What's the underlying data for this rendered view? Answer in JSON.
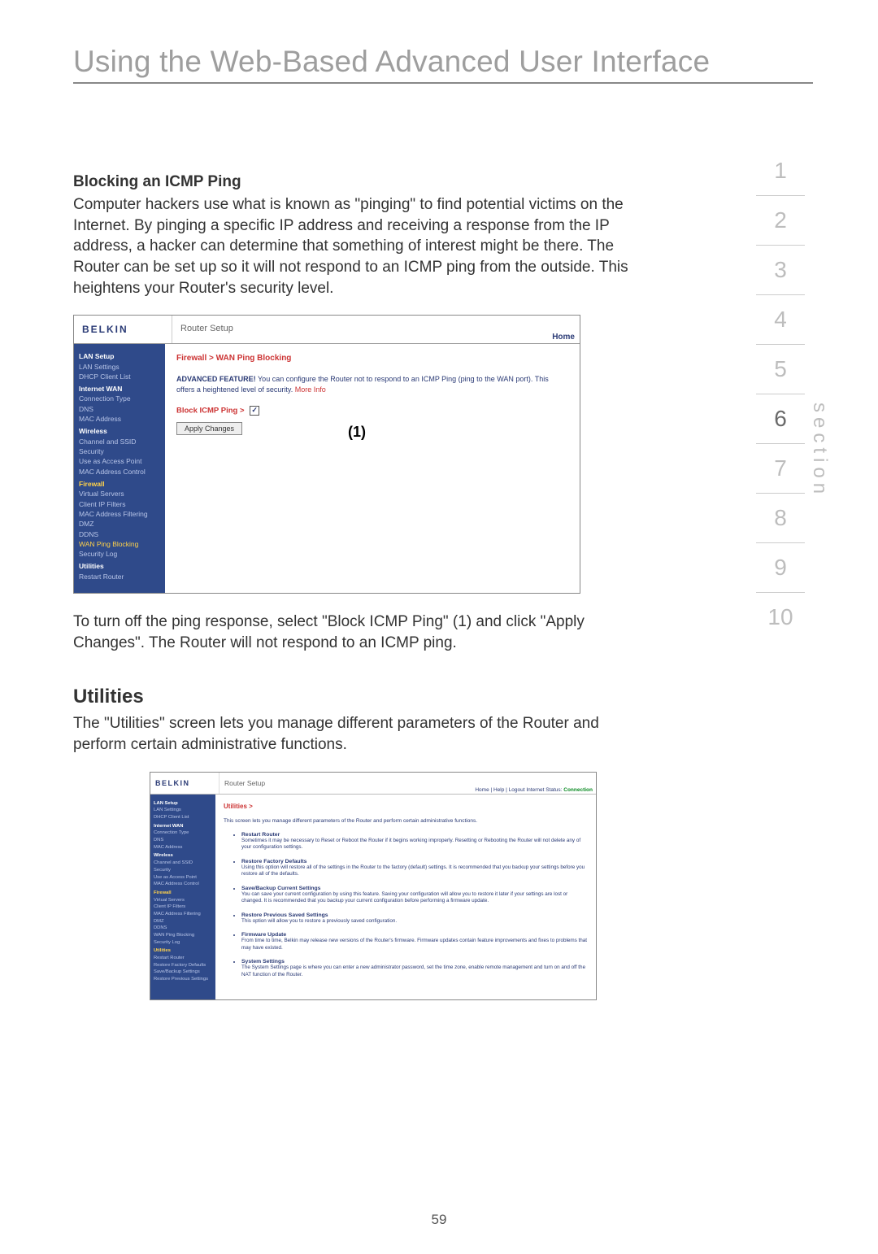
{
  "page_title": "Using the Web-Based Advanced User Interface",
  "sections": {
    "items": [
      "1",
      "2",
      "3",
      "4",
      "5",
      "6",
      "7",
      "8",
      "9",
      "10"
    ],
    "active": "6",
    "label": "section"
  },
  "block_icmp": {
    "heading": "Blocking an ICMP Ping",
    "paragraph": "Computer hackers use what is known as \"pinging\" to find potential victims on the Internet. By pinging a specific IP address and receiving a response from the IP address, a hacker can determine that something of interest might be there. The Router can be set up so it will not respond to an ICMP ping from the outside. This heightens your Router's security level.",
    "after_shot": "To turn off the ping response, select \"Block ICMP Ping\" (1) and click \"Apply Changes\". The Router will not respond to an ICMP ping."
  },
  "utilities": {
    "heading": "Utilities",
    "paragraph": "The \"Utilities\" screen lets you manage different parameters of the Router and perform certain administrative functions."
  },
  "shot1": {
    "logo": "BELKIN",
    "title": "Router Setup",
    "home": "Home",
    "nav": {
      "lan_setup": "LAN Setup",
      "lan_settings": "LAN Settings",
      "dhcp_client_list": "DHCP Client List",
      "internet_wan": "Internet WAN",
      "connection_type": "Connection Type",
      "dns": "DNS",
      "mac_address": "MAC Address",
      "wireless": "Wireless",
      "channel_ssid": "Channel and SSID",
      "security": "Security",
      "use_as_ap": "Use as Access Point",
      "mac_addr_ctrl": "MAC Address Control",
      "firewall": "Firewall",
      "virtual_servers": "Virtual Servers",
      "client_ip_filters": "Client IP Filters",
      "mac_addr_filter": "MAC Address Filtering",
      "dmz": "DMZ",
      "ddns": "DDNS",
      "wan_ping_block": "WAN Ping Blocking",
      "security_log": "Security Log",
      "utilities": "Utilities",
      "restart_router": "Restart Router"
    },
    "main": {
      "breadcrumb": "Firewall > WAN Ping Blocking",
      "adv_label": "ADVANCED FEATURE!",
      "adv_text": " You can configure the Router not to respond to an ICMP Ping (ping to the WAN port). This offers a heightened level of security. ",
      "more_info": "More Info",
      "block_label": "Block ICMP Ping >",
      "callout": "(1)",
      "apply": "Apply Changes"
    }
  },
  "shot2": {
    "logo": "BELKIN",
    "title": "Router Setup",
    "toplinks_left": "Home | Help | Logout    Internet Status: ",
    "toplinks_status": "Connection",
    "nav": {
      "lan_setup": "LAN Setup",
      "lan_settings": "LAN Settings",
      "dhcp_client_list": "DHCP Client List",
      "internet_wan": "Internet WAN",
      "connection_type": "Connection Type",
      "dns": "DNS",
      "mac_address": "MAC Address",
      "wireless": "Wireless",
      "channel_ssid": "Channel and SSID",
      "security": "Security",
      "use_as_ap": "Use as Access Point",
      "mac_addr_ctrl": "MAC Address Control",
      "firewall": "Firewall",
      "virtual_servers": "Virtual Servers",
      "client_ip_filters": "Client IP Filters",
      "mac_addr_filter": "MAC Address Filtering",
      "dmz": "DMZ",
      "ddns": "DDNS",
      "wan_ping_block": "WAN Ping Blocking",
      "security_log": "Security Log",
      "utilities": "Utilities",
      "restart_router": "Restart Router",
      "restore_defaults": "Restore Factory Defaults",
      "save_backup": "Save/Backup Settings",
      "restore_prev": "Restore Previous Settings"
    },
    "main": {
      "breadcrumb": "Utilities >",
      "intro": "This screen lets you manage different parameters of the Router and perform certain administrative functions.",
      "items": [
        {
          "t": "Restart Router",
          "d": "Sometimes it may be necessary to Reset or Reboot the Router if it begins working improperly. Resetting or Rebooting the Router will not delete any of your configuration settings."
        },
        {
          "t": "Restore Factory Defaults",
          "d": "Using this option will restore all of the settings in the Router to the factory (default) settings. It is recommended that you backup your settings before you restore all of the defaults."
        },
        {
          "t": "Save/Backup Current Settings",
          "d": "You can save your current configuration by using this feature. Saving your configuration will allow you to restore it later if your settings are lost or changed. It is recommended that you backup your current configuration before performing a firmware update."
        },
        {
          "t": "Restore Previous Saved Settings",
          "d": "This option will allow you to restore a previously saved configuration."
        },
        {
          "t": "Firmware Update",
          "d": "From time to time, Belkin may release new versions of the Router's firmware. Firmware updates contain feature improvements and fixes to problems that may have existed."
        },
        {
          "t": "System Settings",
          "d": "The System Settings page is where you can enter a new administrator password, set the time zone, enable remote management and turn on and off the NAT function of the Router."
        }
      ]
    }
  },
  "page_number": "59"
}
